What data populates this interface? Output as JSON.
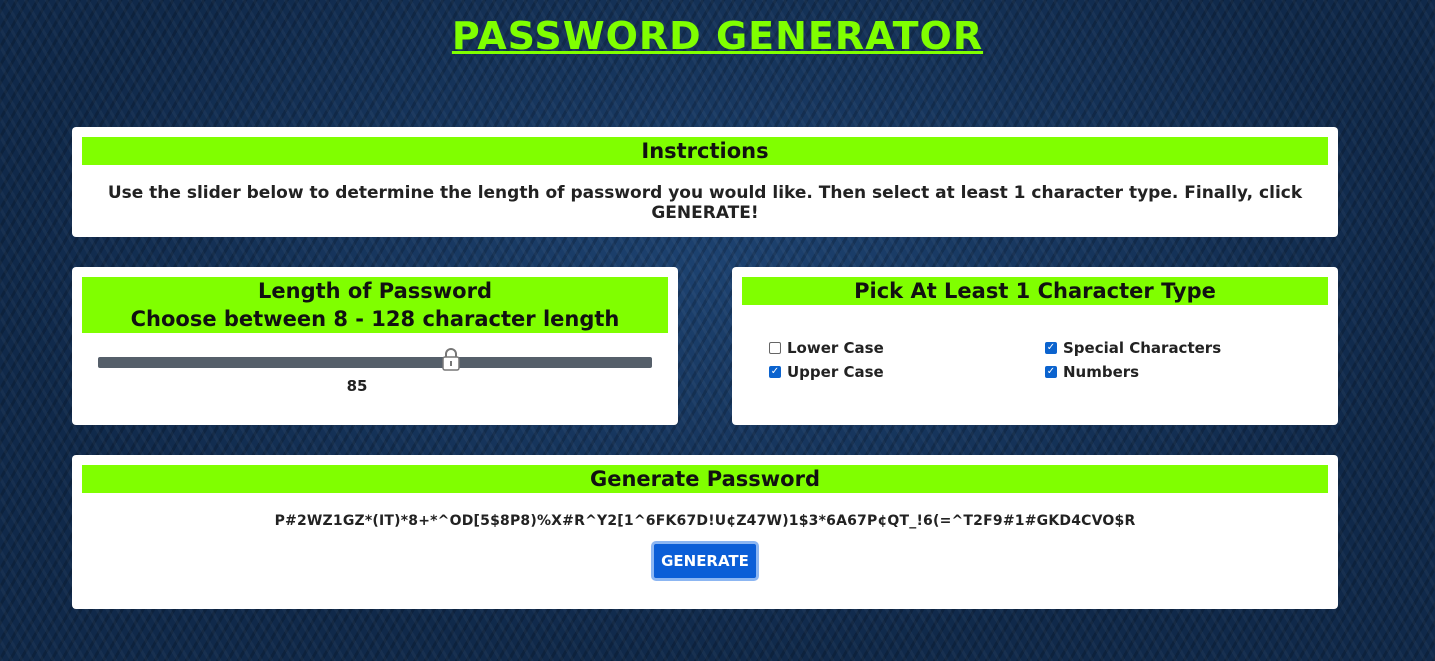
{
  "page": {
    "title": "PASSWORD GENERATOR"
  },
  "instructions": {
    "header": "Instrctions",
    "text": "Use the slider below to determine the length of password you would like. Then select at least 1 character type. Finally, click GENERATE!"
  },
  "length": {
    "header_line1": "Length of Password",
    "header_line2": "Choose between 8 - 128 character length",
    "min": 8,
    "max": 128,
    "value": "85"
  },
  "types": {
    "header": "Pick At Least 1 Character Type",
    "options": [
      {
        "label": "Lower Case",
        "checked": false
      },
      {
        "label": "Special Characters",
        "checked": true
      },
      {
        "label": "Upper Case",
        "checked": true
      },
      {
        "label": "Numbers",
        "checked": true
      }
    ]
  },
  "generate": {
    "header": "Generate Password",
    "password": "P#2WZ1GZ*(IT)*8+*^OD[5$8P8)%X#R^Y2[1^6FK67D!U¢Z47W)1$3*6A67P¢QT_!6(=^T2F9#1#GKD4CVO$R",
    "button_label": "GENERATE"
  },
  "colors": {
    "accent": "#80ff00",
    "button": "#0b5ed7",
    "background": "#10294a"
  },
  "icons": {
    "slider_thumb": "lock-icon"
  }
}
